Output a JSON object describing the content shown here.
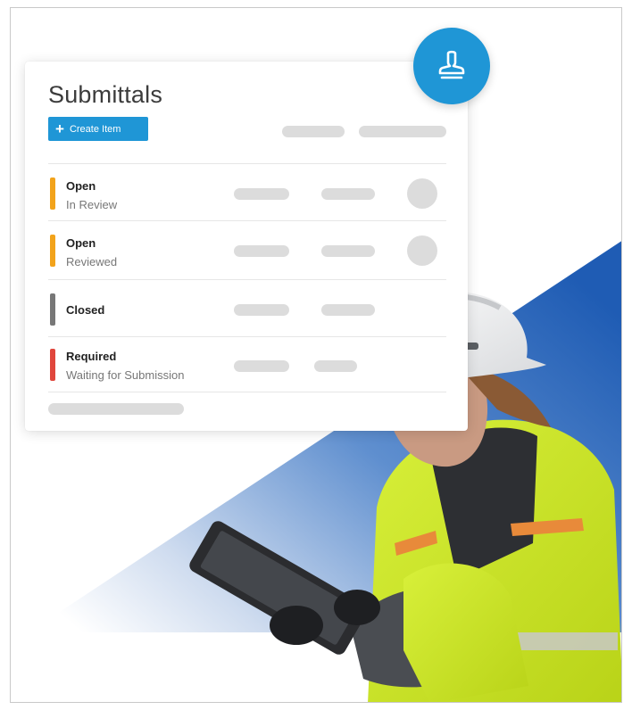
{
  "submittals": {
    "title": "Submittals",
    "create_button_label": "Create Item",
    "stamp_icon": "stamp-icon",
    "rows": [
      {
        "status": "Open",
        "detail": "In Review",
        "color": "#f2a31b"
      },
      {
        "status": "Open",
        "detail": "Reviewed",
        "color": "#f2a31b"
      },
      {
        "status": "Closed",
        "detail": "",
        "color": "#777777"
      },
      {
        "status": "Required",
        "detail": "Waiting for Submission",
        "color": "#e0463c"
      }
    ]
  },
  "colors": {
    "accent": "#1f96d6",
    "placeholder": "#dcdcdc",
    "background_triangle": "#1f5cb4"
  }
}
